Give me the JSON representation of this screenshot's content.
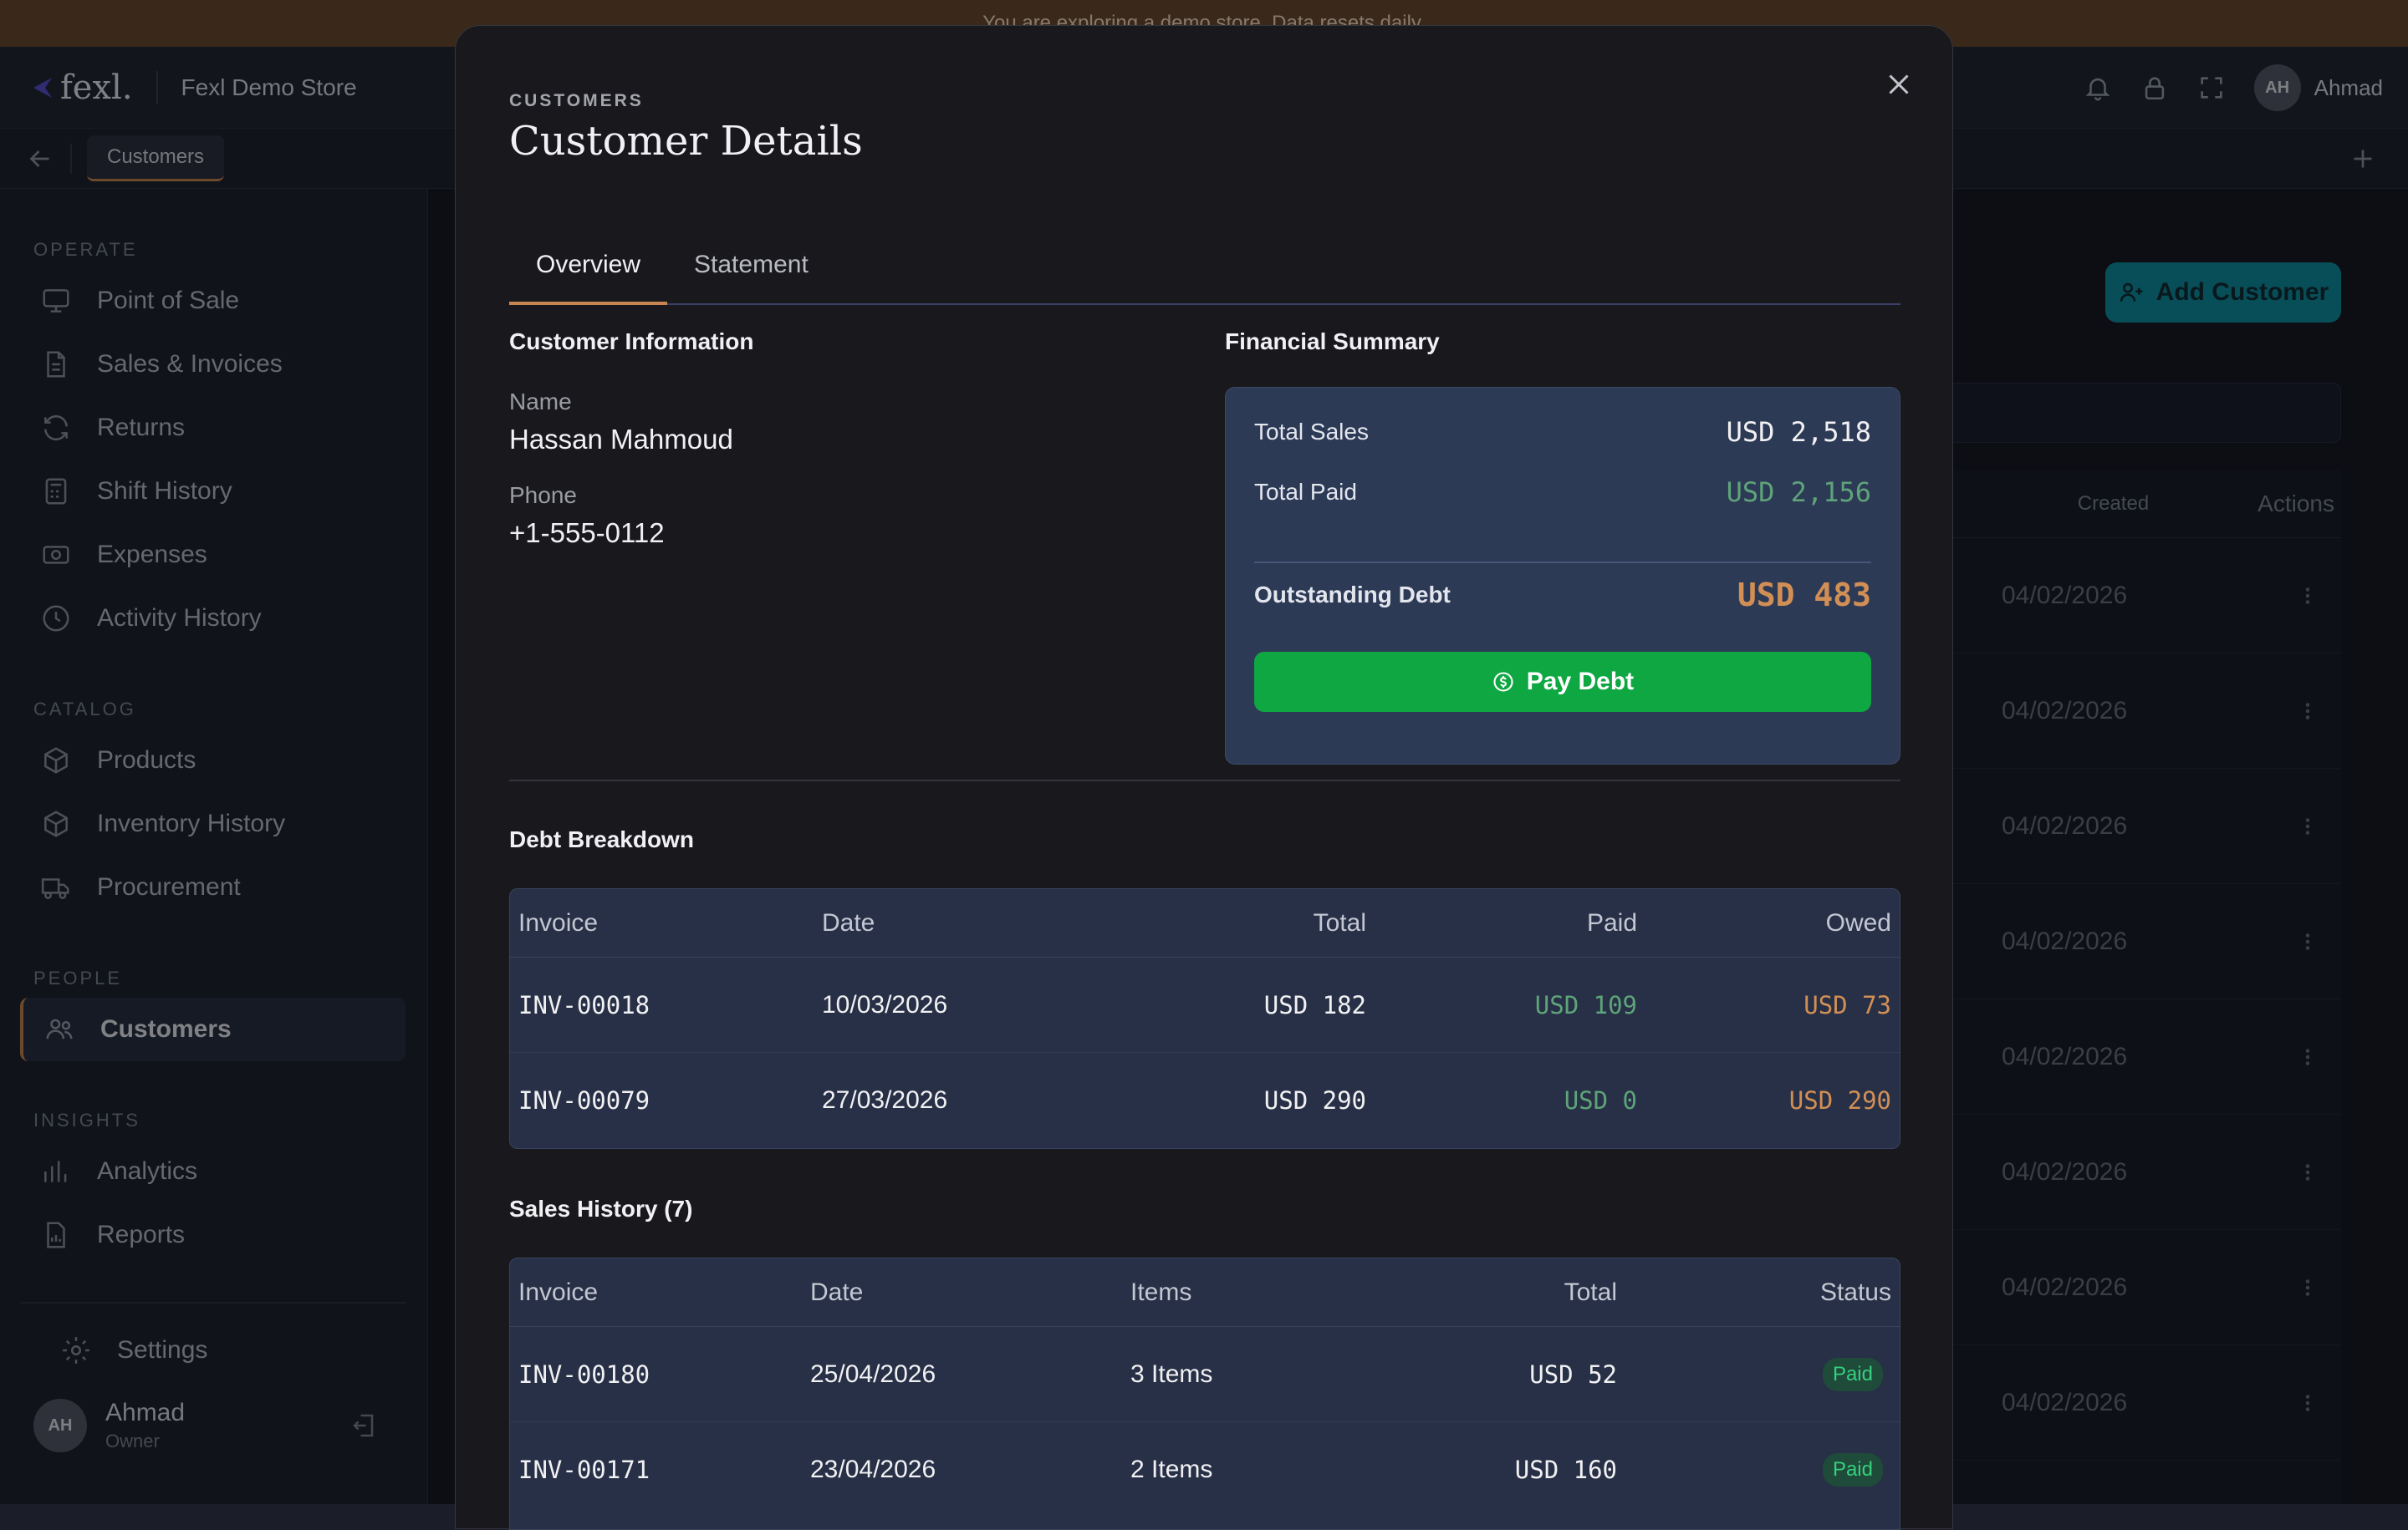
{
  "banner": {
    "text": "You are exploring a demo store. Data resets daily."
  },
  "header": {
    "logo_text": "fexl.",
    "store_name": "Fexl Demo Store",
    "user_initials": "AH",
    "user_name": "Ahmad"
  },
  "tabbar": {
    "active_tab": "Customers"
  },
  "sidebar": {
    "sections": {
      "operate": "OPERATE",
      "catalog": "CATALOG",
      "people": "PEOPLE",
      "insights": "INSIGHTS"
    },
    "items": {
      "pos": "Point of Sale",
      "sales": "Sales & Invoices",
      "returns": "Returns",
      "shift": "Shift History",
      "expenses": "Expenses",
      "activity": "Activity History",
      "products": "Products",
      "inventory": "Inventory History",
      "procurement": "Procurement",
      "customers": "Customers",
      "analytics": "Analytics",
      "reports": "Reports",
      "settings": "Settings"
    },
    "user": {
      "initials": "AH",
      "name": "Ahmad",
      "role": "Owner"
    }
  },
  "background": {
    "add_customer_label": "Add Customer",
    "col_created": "Created",
    "col_actions": "Actions",
    "rows": [
      "04/02/2026",
      "04/02/2026",
      "04/02/2026",
      "04/02/2026",
      "04/02/2026",
      "04/02/2026",
      "04/02/2026",
      "04/02/2026"
    ]
  },
  "modal": {
    "eyebrow": "CUSTOMERS",
    "title": "Customer Details",
    "tabs": {
      "overview": "Overview",
      "statement": "Statement"
    },
    "customer_info": {
      "title": "Customer Information",
      "name_label": "Name",
      "name_value": "Hassan Mahmoud",
      "phone_label": "Phone",
      "phone_value": "+1-555-0112"
    },
    "financial": {
      "title": "Financial Summary",
      "total_sales_label": "Total Sales",
      "total_sales_value": "USD 2,518",
      "total_paid_label": "Total Paid",
      "total_paid_value": "USD 2,156",
      "debt_label": "Outstanding Debt",
      "debt_value": "USD 483",
      "pay_button": "Pay Debt"
    },
    "debt_breakdown": {
      "title": "Debt Breakdown",
      "headers": {
        "invoice": "Invoice",
        "date": "Date",
        "total": "Total",
        "paid": "Paid",
        "owed": "Owed"
      },
      "rows": [
        {
          "invoice": "INV-00018",
          "date": "10/03/2026",
          "total": "USD 182",
          "paid": "USD 109",
          "owed": "USD 73"
        },
        {
          "invoice": "INV-00079",
          "date": "27/03/2026",
          "total": "USD 290",
          "paid": "USD 0",
          "owed": "USD 290"
        }
      ]
    },
    "sales_history": {
      "title": "Sales History (7)",
      "headers": {
        "invoice": "Invoice",
        "date": "Date",
        "items": "Items",
        "total": "Total",
        "status": "Status"
      },
      "rows": [
        {
          "invoice": "INV-00180",
          "date": "25/04/2026",
          "items": "3 Items",
          "total": "USD 52",
          "status": "Paid"
        },
        {
          "invoice": "INV-00171",
          "date": "23/04/2026",
          "items": "2 Items",
          "total": "USD 160",
          "status": "Paid"
        }
      ]
    }
  },
  "colors": {
    "accent": "#c7854f",
    "pay_button": "#0ea742",
    "add_customer": "#0f8fa0",
    "paid_green": "#5ea37a",
    "owed_orange": "#d28f55"
  }
}
